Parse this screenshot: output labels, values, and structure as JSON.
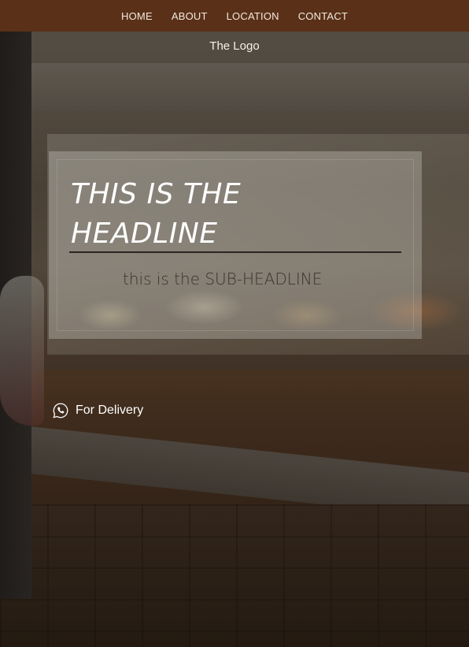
{
  "nav": {
    "items": [
      {
        "label": "HOME"
      },
      {
        "label": "ABOUT"
      },
      {
        "label": "LOCATION"
      },
      {
        "label": "CONTACT"
      }
    ]
  },
  "logo": {
    "text": "The Logo"
  },
  "hero": {
    "headline": "THIS IS THE HEADLINE",
    "subheadline": "this is the SUB-HEADLINE"
  },
  "delivery": {
    "label": "For Delivery",
    "icon": "whatsapp-icon"
  },
  "colors": {
    "navbar_bg": "#5a3118",
    "nav_text": "#f3e9e0",
    "headline": "#ffffff",
    "subheadline": "#3a3330"
  }
}
